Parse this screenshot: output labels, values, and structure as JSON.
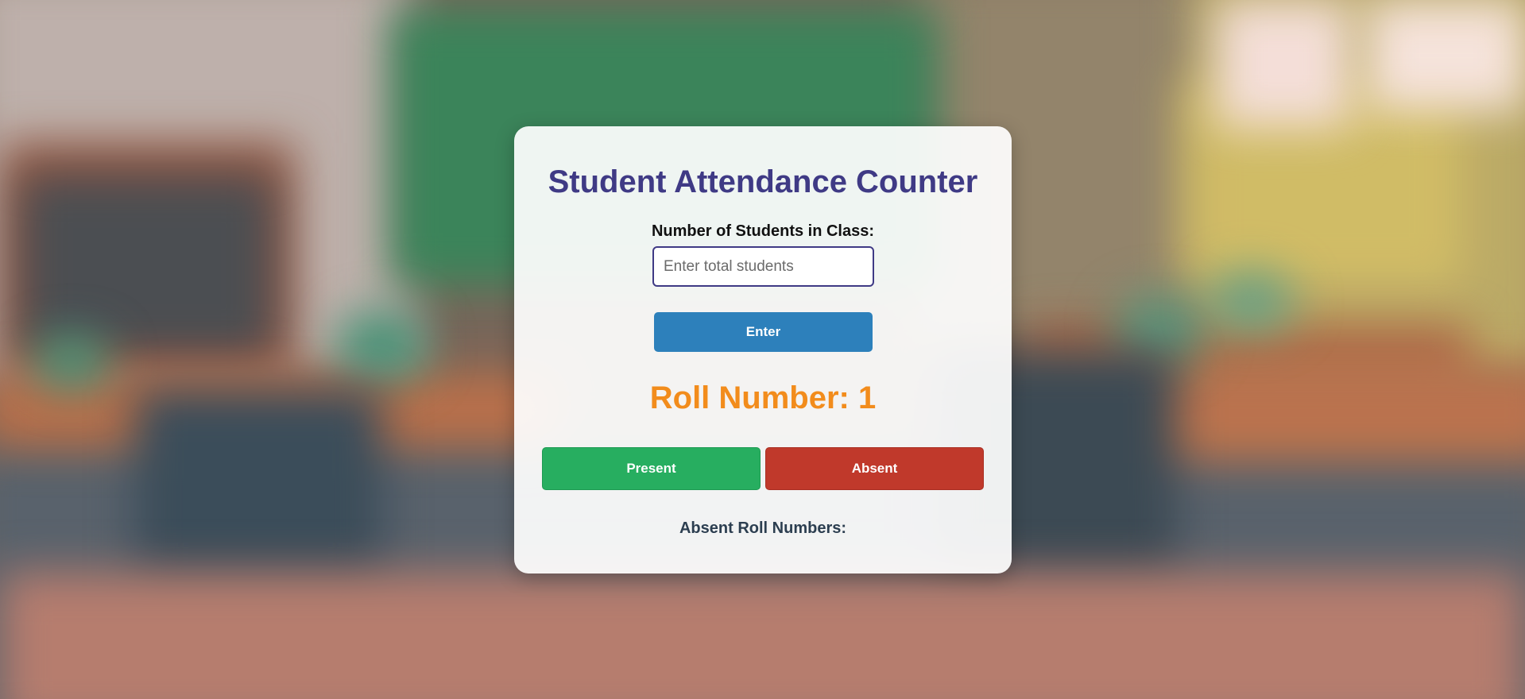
{
  "app": {
    "title": "Student Attendance Counter"
  },
  "class_size": {
    "label": "Number of Students in Class:",
    "value": "",
    "placeholder": "Enter total students",
    "enter_label": "Enter"
  },
  "roll": {
    "text": "Roll Number: 1"
  },
  "actions": {
    "present_label": "Present",
    "absent_label": "Absent"
  },
  "absent_list": {
    "label": "Absent Roll Numbers:",
    "items": ""
  },
  "colors": {
    "title": "#3f3a85",
    "enter_button": "#2d80bb",
    "roll_number": "#f28c1c",
    "present_button": "#27ae60",
    "absent_button": "#c0392b"
  }
}
